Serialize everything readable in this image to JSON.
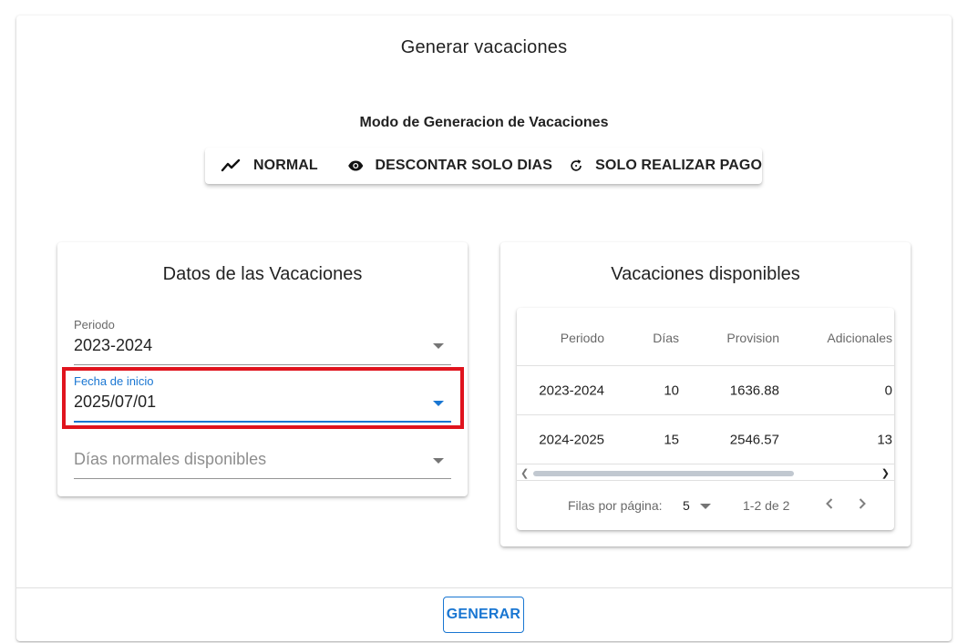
{
  "dialog": {
    "title": "Generar vacaciones",
    "mode_label": "Modo de Generacion de Vacaciones",
    "modes": [
      {
        "label": "NORMAL",
        "icon": "trending-up-icon"
      },
      {
        "label": "DESCONTAR SOLO DIAS",
        "icon": "eye-icon"
      },
      {
        "label": "SOLO REALIZAR PAGO",
        "icon": "refresh-icon"
      }
    ],
    "generate_label": "GENERAR"
  },
  "datos": {
    "title": "Datos de las Vacaciones",
    "periodo_label": "Periodo",
    "periodo_value": "2023-2024",
    "fecha_label": "Fecha de inicio",
    "fecha_value": "2025/07/01",
    "dias_placeholder": "Días normales disponibles"
  },
  "disponibles": {
    "title": "Vacaciones disponibles",
    "columns": [
      "Periodo",
      "Días",
      "Provision",
      "Adicionales"
    ],
    "rows": [
      [
        "2023-2024",
        "10",
        "1636.88",
        "0"
      ],
      [
        "2024-2025",
        "15",
        "2546.57",
        "13"
      ]
    ],
    "footer": {
      "rows_per_page_label": "Filas por página:",
      "rows_per_page_value": "5",
      "range": "1-2 de 2"
    }
  },
  "colors": {
    "primary": "#1976d2",
    "highlight": "#e0141e"
  }
}
